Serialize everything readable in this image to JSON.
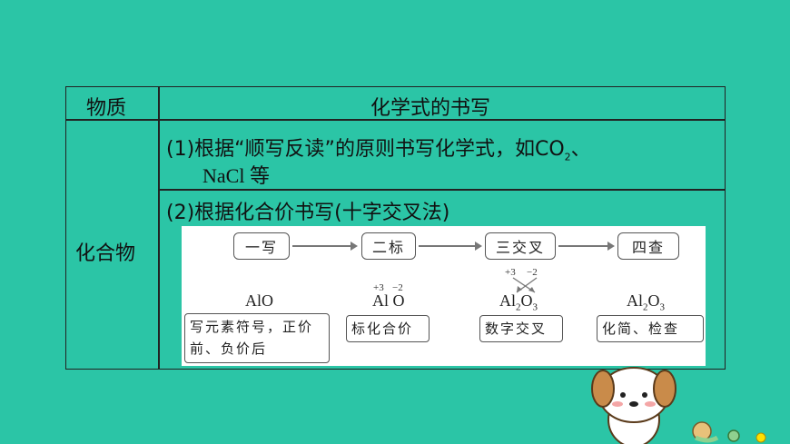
{
  "table": {
    "header_col1": "物质",
    "header_col2": "化学式的书写",
    "row_label": "化合物",
    "method1_line1_pre": "(1)根据“顺写反读”的原则书写化学式，如CO",
    "method1_sub": "2",
    "method1_post": "、",
    "method1_line2": "NaCl 等",
    "method2": "(2)根据化合价书写(十字交叉法)"
  },
  "diagram": {
    "steps": [
      "一写",
      "二标",
      "三交叉",
      "四查"
    ],
    "formula1": "AlO",
    "formula2": "Al O",
    "valence2_al": "+3",
    "valence2_o": "−2",
    "formula3_el1": "Al",
    "formula3_sub1": "2",
    "formula3_el2": "O",
    "formula3_sub2": "3",
    "valence3_al": "+3",
    "valence3_o": "−2",
    "formula4_el1": "Al",
    "formula4_sub1": "2",
    "formula4_el2": "O",
    "formula4_sub2": "3",
    "notes": [
      "写元素符号，正价前、负价后",
      "标化合价",
      "数字交叉",
      "化简、检查"
    ]
  },
  "colors": {
    "background": "#2bc5a6",
    "border": "#222222"
  }
}
